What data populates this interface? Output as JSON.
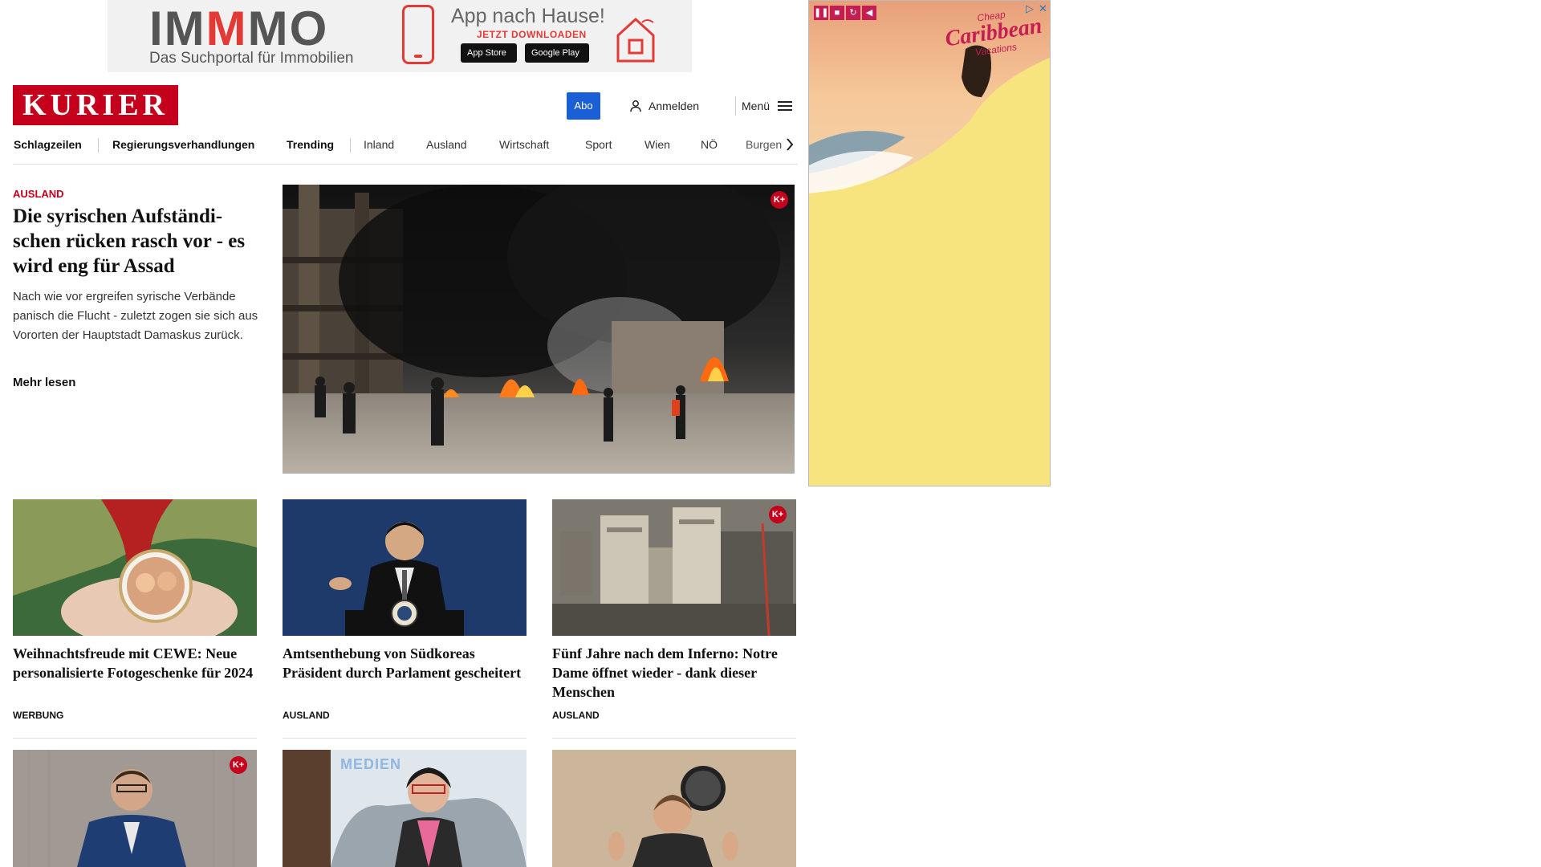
{
  "top_ad": {
    "brand_left": "IM",
    "brand_mid": "M",
    "brand_right": "MO",
    "tagline": "Das Suchportal für Immobilien",
    "headline": "App nach Hause!",
    "cta": "JETZT DOWNLOADEN",
    "apple_label": "App Store",
    "google_label": "Google Play"
  },
  "header": {
    "logo": "KURIER",
    "abo": "Abo",
    "login": "Anmelden",
    "menu": "Menü"
  },
  "nav": {
    "items": [
      "Schlagzeilen",
      "Regierungsverhandlungen",
      "Trending",
      "Inland",
      "Ausland",
      "Wirtschaft",
      "Sport",
      "Wien",
      "NÖ",
      "Burgen"
    ]
  },
  "hero": {
    "kicker": "AUSLAND",
    "title": "Die syrischen Aufständi-schen rücken rasch vor - es wird eng für Assad",
    "teaser": "Nach wie vor ergreifen syrische Verbände panisch die Flucht - zuletzt zogen sie sich aus Vororten der Hauptstadt Damaskus zurück.",
    "more": "Mehr lesen",
    "badge": "K+"
  },
  "cards": [
    {
      "title": "Weihnachtsfreude mit CEWE: Neue personalisierte Fotogeschenke für 2024",
      "kicker": "WERBUNG"
    },
    {
      "title": "Amtsenthebung von Südkoreas Präsident durch Parlament gescheitert",
      "kicker": "AUSLAND"
    },
    {
      "title": "Fünf Jahre nach dem Inferno: Notre Dame öffnet wieder - dank dieser Menschen",
      "kicker": "AUSLAND",
      "badge": "K+"
    }
  ],
  "cards_row2": [
    {
      "badge": "K+",
      "img_text": ""
    },
    {
      "img_text": "MEDIEN"
    },
    {}
  ],
  "side_ad": {
    "line1": "Cheap",
    "line2": "Caribbean",
    "line3": "Vacations",
    "play_icon": "▷",
    "close_icon": "✕"
  },
  "colors": {
    "brand_red": "#c4001d",
    "abo_blue": "#1a5fd6",
    "ad_yellow": "#f7e47e"
  }
}
